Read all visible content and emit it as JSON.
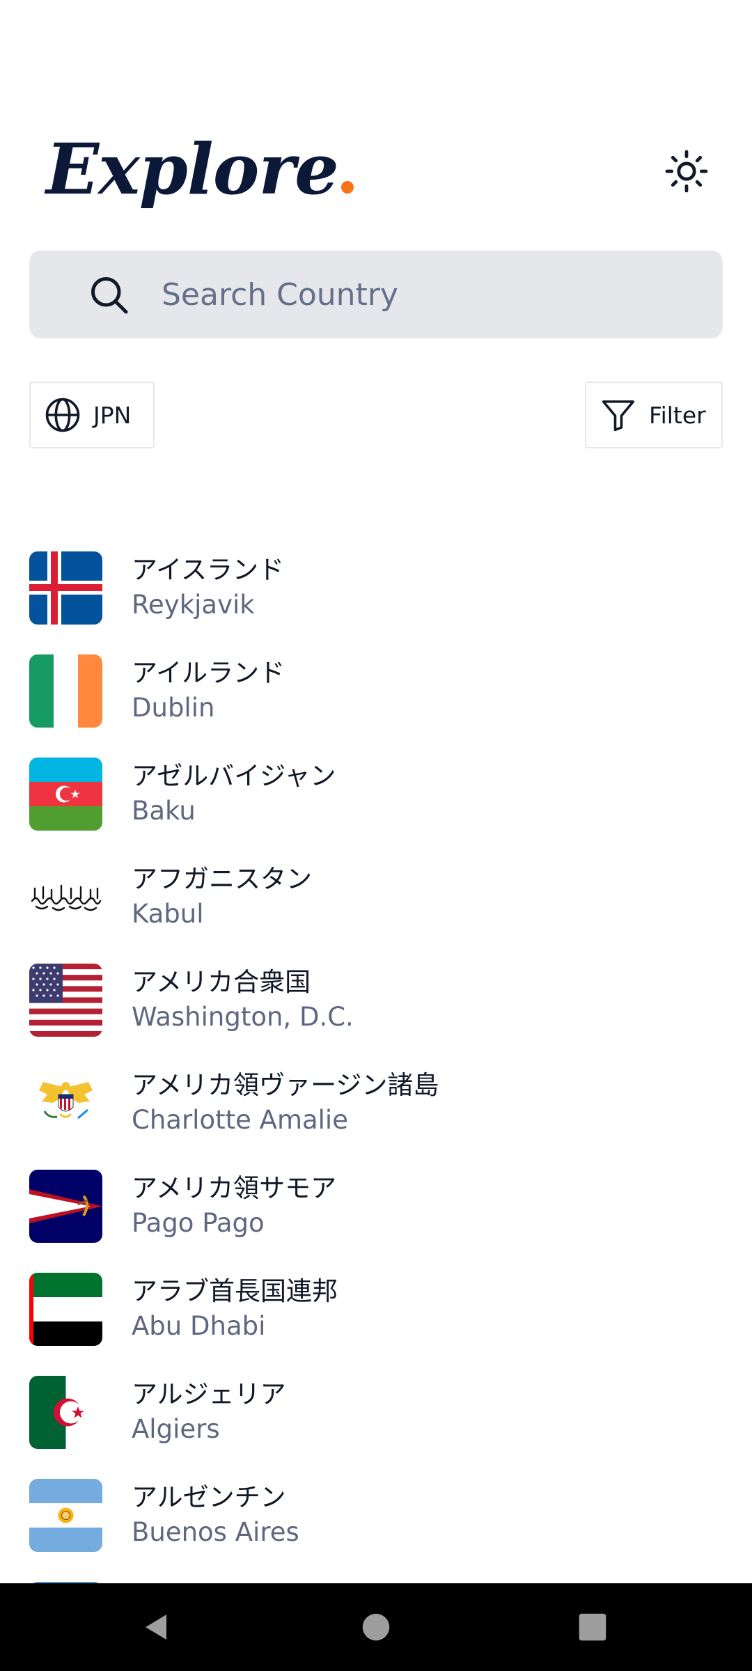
{
  "header": {
    "title": "Explore",
    "accent_color": "#f97316",
    "title_color": "#0b1838",
    "theme_icon": "sun-icon"
  },
  "search": {
    "placeholder": "Search Country",
    "value": ""
  },
  "controls": {
    "language_label": "JPN",
    "language_icon": "globe-icon",
    "filter_label": "Filter",
    "filter_icon": "filter-icon"
  },
  "countries": [
    {
      "name": "アイスランド",
      "capital": "Reykjavik",
      "flag": "iceland"
    },
    {
      "name": "アイルランド",
      "capital": "Dublin",
      "flag": "ireland"
    },
    {
      "name": "アゼルバイジャン",
      "capital": "Baku",
      "flag": "azerbaijan"
    },
    {
      "name": "アフガニスタン",
      "capital": "Kabul",
      "flag": "afghanistan"
    },
    {
      "name": "アメリカ合衆国",
      "capital": "Washington, D.C.",
      "flag": "usa"
    },
    {
      "name": "アメリカ領ヴァージン諸島",
      "capital": "Charlotte Amalie",
      "flag": "us-virgin-islands"
    },
    {
      "name": "アメリカ領サモア",
      "capital": "Pago Pago",
      "flag": "american-samoa"
    },
    {
      "name": "アラブ首長国連邦",
      "capital": "Abu Dhabi",
      "flag": "uae"
    },
    {
      "name": "アルジェリア",
      "capital": "Algiers",
      "flag": "algeria"
    },
    {
      "name": "アルゼンチン",
      "capital": "Buenos Aires",
      "flag": "argentina"
    }
  ],
  "navbar": {
    "back_icon": "back-triangle-icon",
    "home_icon": "home-circle-icon",
    "recents_icon": "recents-square-icon"
  }
}
